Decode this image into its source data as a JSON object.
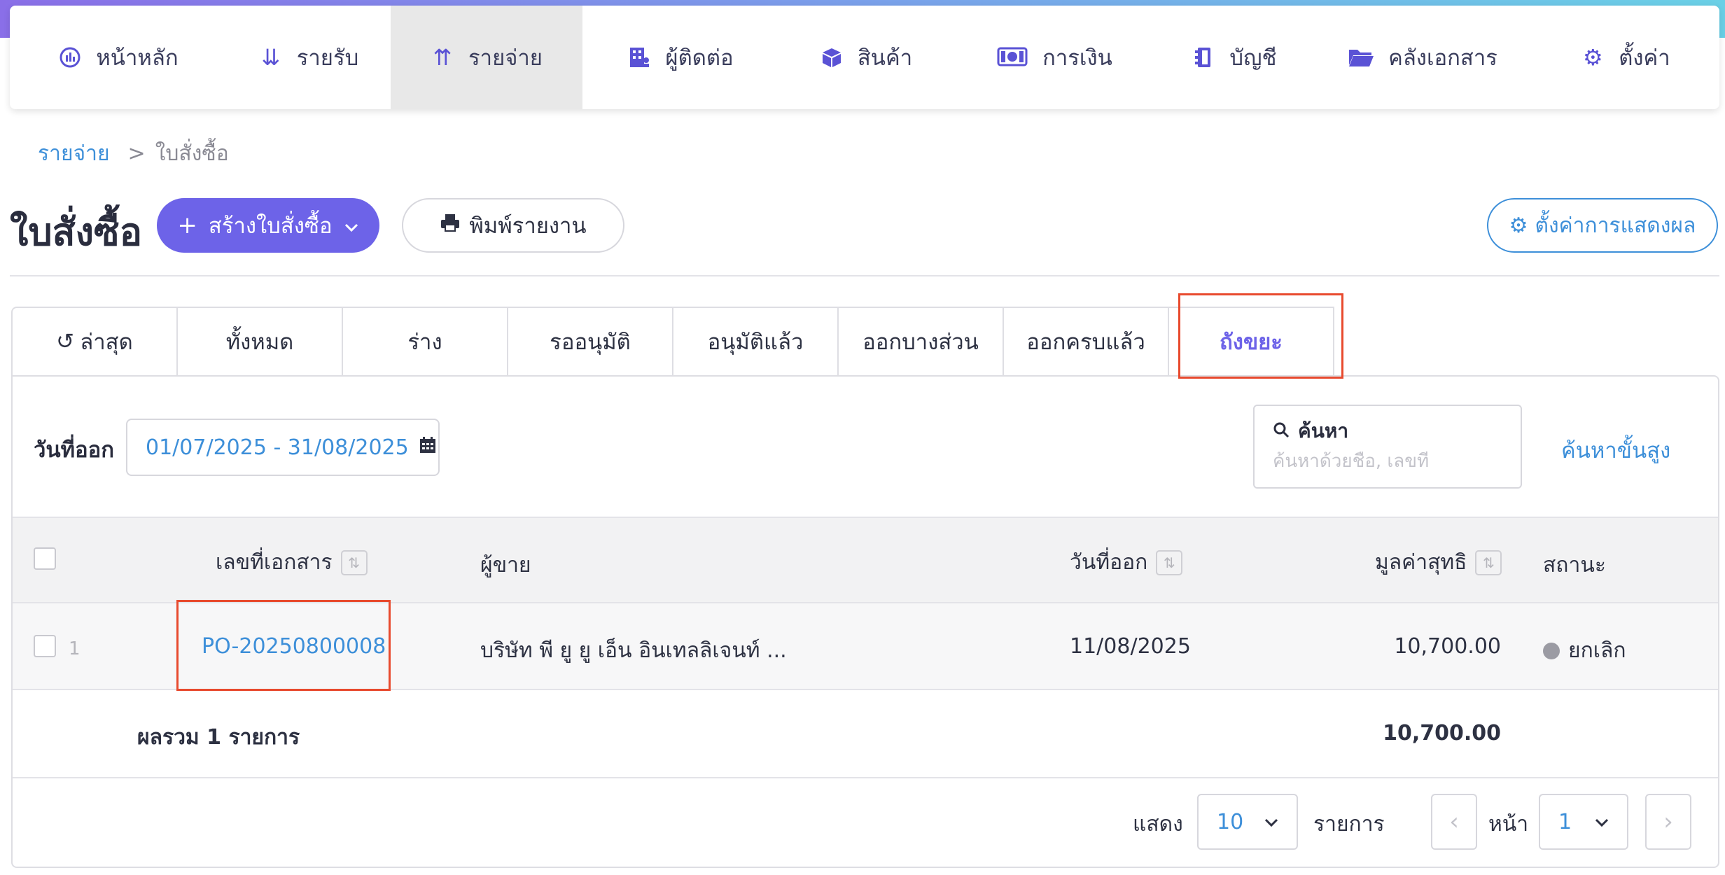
{
  "nav": {
    "items": [
      {
        "label": "หน้าหลัก",
        "icon": "dashboard-icon"
      },
      {
        "label": "รายรับ",
        "icon": "income-sort-icon"
      },
      {
        "label": "รายจ่าย",
        "icon": "expense-sort-icon"
      },
      {
        "label": "ผู้ติดต่อ",
        "icon": "contacts-building-icon"
      },
      {
        "label": "สินค้า",
        "icon": "box-icon"
      },
      {
        "label": "การเงิน",
        "icon": "money-icon"
      },
      {
        "label": "บัญชี",
        "icon": "ledger-book-icon"
      },
      {
        "label": "คลังเอกสาร",
        "icon": "folder-icon"
      },
      {
        "label": "ตั้งค่า",
        "icon": "gear-icon"
      }
    ],
    "active_index": 2
  },
  "breadcrumb": {
    "parent": "รายจ่าย",
    "separator": ">",
    "current": "ใบสั่งซื้อ"
  },
  "page": {
    "title": "ใบสั่งซื้อ",
    "create_label": "สร้างใบสั่งซื้อ",
    "print_label": "พิมพ์รายงาน",
    "display_settings_label": "ตั้งค่าการแสดงผล"
  },
  "tabs": [
    {
      "label": "ล่าสุด"
    },
    {
      "label": "ทั้งหมด"
    },
    {
      "label": "ร่าง"
    },
    {
      "label": "รออนุมัติ"
    },
    {
      "label": "อนุมัติแล้ว"
    },
    {
      "label": "ออกบางส่วน"
    },
    {
      "label": "ออกครบแล้ว"
    },
    {
      "label": "ถังขยะ"
    }
  ],
  "active_tab": 7,
  "filters": {
    "date_label": "วันที่ออก",
    "date_range": "01/07/2025 - 31/08/2025",
    "search_label": "ค้นหา",
    "search_placeholder": "ค้นหาด้วยชื่อ, เลขที่",
    "advanced_label": "ค้นหาขั้นสูง"
  },
  "table": {
    "headers": {
      "doc_no": "เลขที่เอกสาร",
      "vendor": "ผู้ขาย",
      "issue_date": "วันที่ออก",
      "net_value": "มูลค่าสุทธิ",
      "status": "สถานะ"
    },
    "rows": [
      {
        "index": "1",
        "doc_no": "PO-20250800008",
        "vendor": "บริษัท พี ยู ยู เอ็น อินเทลลิเจนท์ ...",
        "issue_date": "11/08/2025",
        "net_value": "10,700.00",
        "status": "ยกเลิก"
      }
    ],
    "summary": {
      "label": "ผลรวม 1 รายการ",
      "total": "10,700.00"
    }
  },
  "pagination": {
    "show_label": "แสดง",
    "page_size": "10",
    "items_label": "รายการ",
    "page_label": "หน้า",
    "page": "1"
  },
  "colors": {
    "accent": "#6d63e8",
    "link": "#3d8fd9",
    "highlight": "#e84a2e",
    "status_cancelled": "#9b9ba3"
  }
}
